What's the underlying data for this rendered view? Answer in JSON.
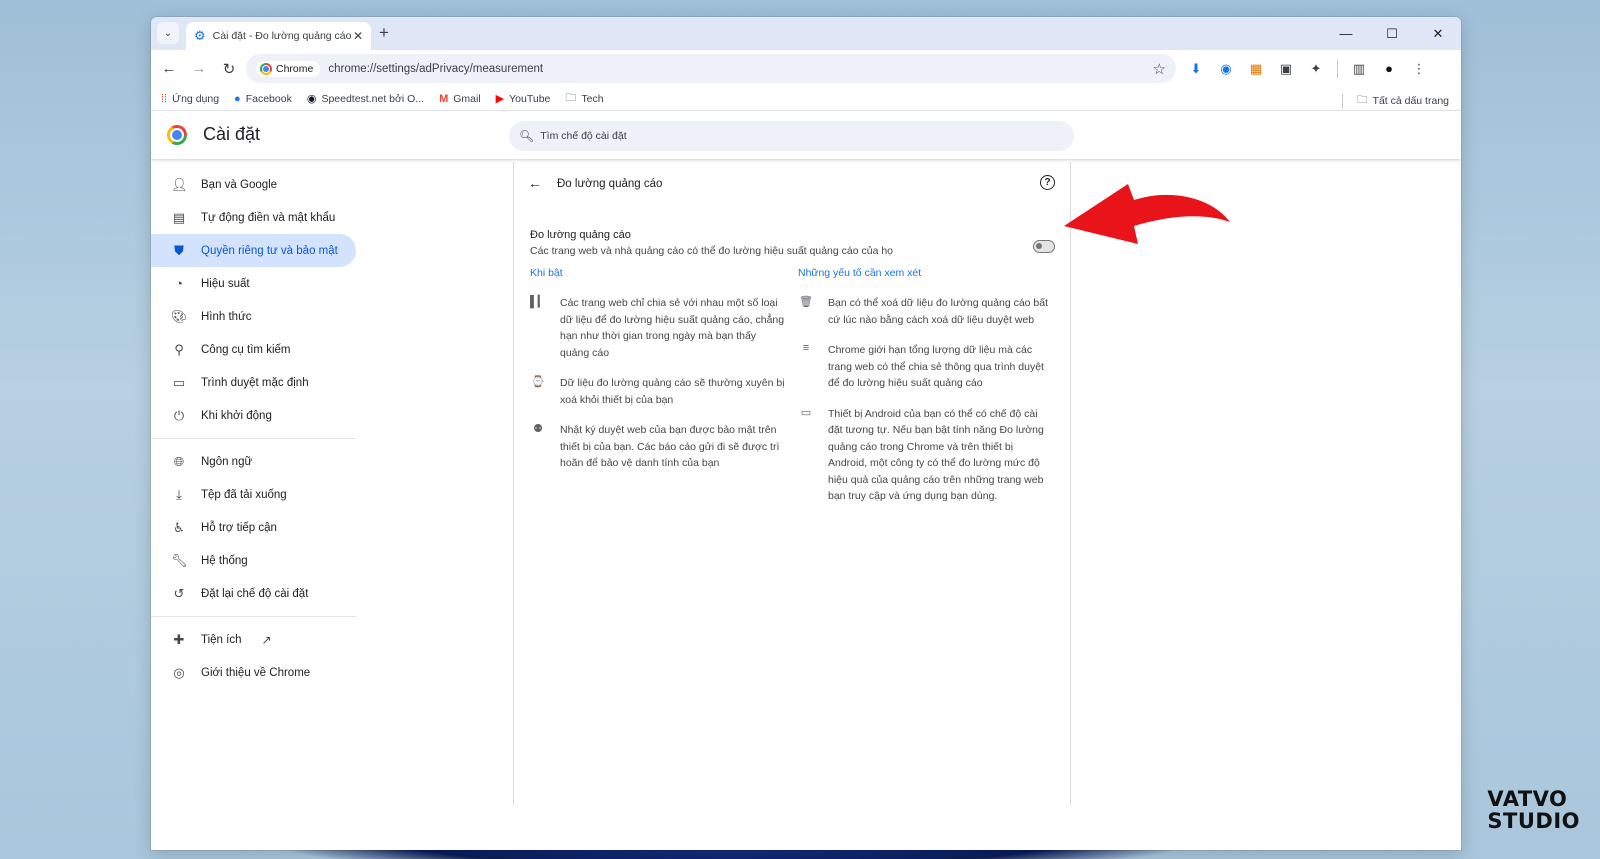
{
  "window": {
    "tab_title": "Cài đặt - Đo lường quảng cáo",
    "close_tab": "✕",
    "new_tab": "+",
    "minimize": "—",
    "maximize": "☐",
    "close_window": "✕"
  },
  "toolbar": {
    "chip_label": "Chrome",
    "url": "chrome://settings/adPrivacy/measurement"
  },
  "bookmarks": {
    "items": [
      {
        "label": "Ứng dụng",
        "icon": "apps-grid-icon"
      },
      {
        "label": "Facebook",
        "icon": "facebook-icon"
      },
      {
        "label": "Speedtest.net bởi O...",
        "icon": "speedtest-icon"
      },
      {
        "label": "Gmail",
        "icon": "gmail-icon"
      },
      {
        "label": "YouTube",
        "icon": "youtube-icon"
      },
      {
        "label": "Tech",
        "icon": "folder-icon"
      }
    ],
    "all_bookmarks": "Tất cả dấu trang"
  },
  "settings": {
    "title": "Cài đặt",
    "search_placeholder": "Tìm chế độ cài đặt"
  },
  "sidebar": {
    "items": [
      {
        "label": "Bạn và Google",
        "icon": "person-icon"
      },
      {
        "label": "Tự động điền và mật khẩu",
        "icon": "clipboard-icon"
      },
      {
        "label": "Quyền riêng tư và bảo mật",
        "icon": "shield-icon",
        "active": true
      },
      {
        "label": "Hiệu suất",
        "icon": "speedometer-icon"
      },
      {
        "label": "Hình thức",
        "icon": "palette-icon"
      },
      {
        "label": "Công cụ tìm kiếm",
        "icon": "search-icon"
      },
      {
        "label": "Trình duyệt mặc định",
        "icon": "browser-icon"
      },
      {
        "label": "Khi khởi động",
        "icon": "power-icon"
      },
      {
        "label": "Ngôn ngữ",
        "icon": "globe-icon"
      },
      {
        "label": "Tệp đã tải xuống",
        "icon": "download-icon"
      },
      {
        "label": "Hỗ trợ tiếp cận",
        "icon": "accessibility-icon"
      },
      {
        "label": "Hệ thống",
        "icon": "wrench-icon"
      },
      {
        "label": "Đặt lại chế độ cài đặt",
        "icon": "reset-icon"
      },
      {
        "label": "Tiện ích",
        "icon": "puzzle-icon"
      },
      {
        "label": "Giới thiệu về Chrome",
        "icon": "chrome-icon"
      }
    ]
  },
  "panel": {
    "title": "Đo lường quảng cáo",
    "toggle_title": "Đo lường quảng cáo",
    "toggle_desc": "Các trang web và nhà quảng cáo có thể đo lường hiệu suất quảng cáo của họ",
    "toggle_on": false,
    "left_head": "Khi bật",
    "left_points": [
      "Các trang web chỉ chia sẻ với nhau một số loại dữ liệu để đo lường hiệu suất quảng cáo, chẳng hạn như thời gian trong ngày mà bạn thấy quảng cáo",
      "Dữ liệu đo lường quảng cáo sẽ thường xuyên bị xoá khỏi thiết bị của bạn",
      "Nhật ký duyệt web của bạn được bảo mật trên thiết bị của bạn. Các báo cáo gửi đi sẽ được trì hoãn để bảo vệ danh tính của bạn"
    ],
    "right_head": "Những yếu tố cần xem xét",
    "right_points": [
      "Bạn có thể xoá dữ liệu đo lường quảng cáo bất cứ lúc nào bằng cách xoá dữ liệu duyệt web",
      "Chrome giới hạn tổng lượng dữ liệu mà các trang web có thể chia sẻ thông qua trình duyệt để đo lường hiệu suất quảng cáo",
      "Thiết bị Android của bạn có thể có chế độ cài đặt tương tự. Nếu bạn bật tính năng Đo lường quảng cáo trong Chrome và trên thiết bị Android, một công ty có thể đo lường mức độ hiệu quả của quảng cáo trên những trang web bạn truy cập và ứng dụng bạn dùng."
    ]
  },
  "watermark": {
    "line1": "VATVO",
    "line2": "STUDIO"
  },
  "colors": {
    "accent": "#1a73e8",
    "active_nav_bg": "#d3e3fd",
    "annotation_arrow": "#e8141a"
  }
}
